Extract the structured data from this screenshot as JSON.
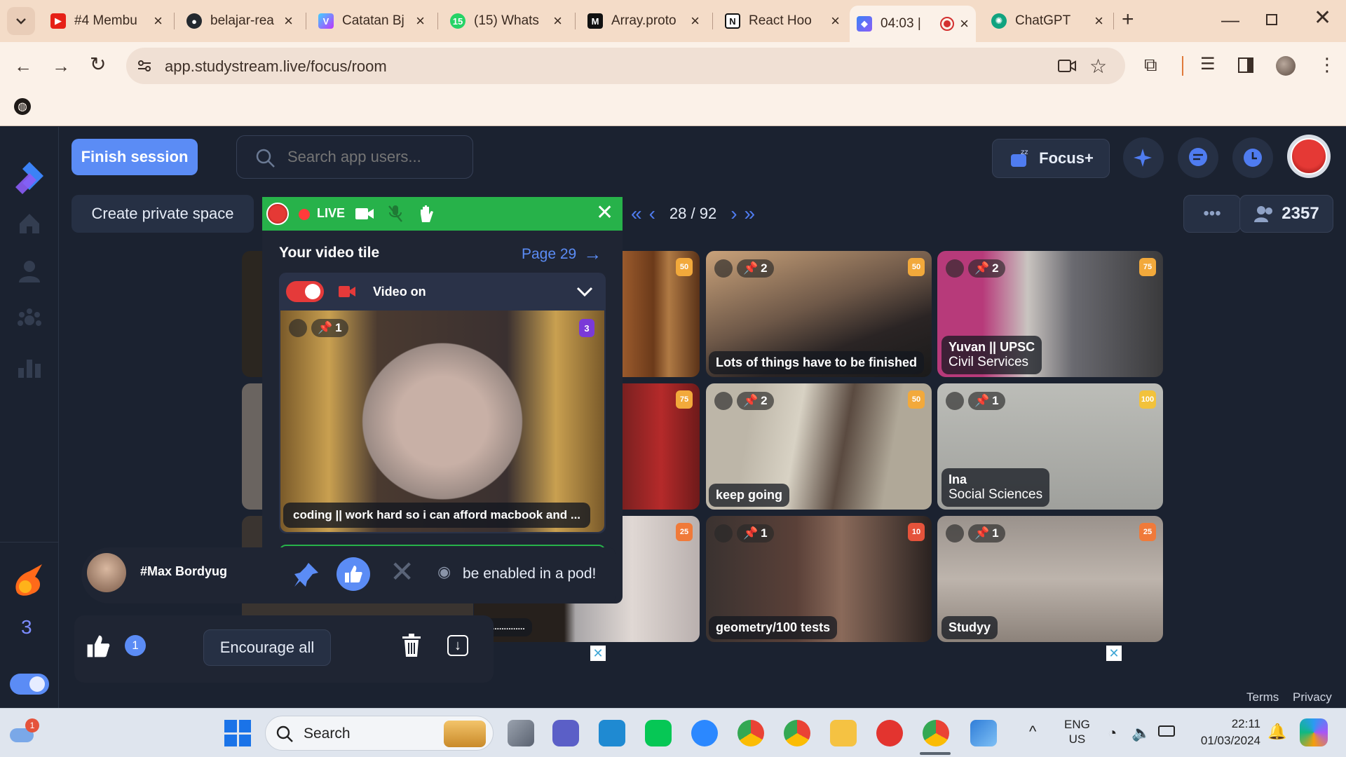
{
  "browser": {
    "tabs": [
      {
        "title": "#4 Membu",
        "favicon": "youtube-icon",
        "color": "#e62117",
        "active": false
      },
      {
        "title": "belajar-rea",
        "favicon": "github-icon",
        "color": "#24292f",
        "active": false
      },
      {
        "title": "Catatan Bj",
        "favicon": "vite-icon",
        "color": "#8a5cf6",
        "active": false
      },
      {
        "title": "(15) Whats",
        "favicon": "whatsapp-icon",
        "color": "#25d366",
        "active": false
      },
      {
        "title": "Array.proto",
        "favicon": "mdn-icon",
        "color": "#111111",
        "active": false
      },
      {
        "title": "React Hoo",
        "favicon": "notion-icon",
        "color": "#111111",
        "active": false
      },
      {
        "title": "04:03 |",
        "favicon": "studystream-icon",
        "color": "#3b82f6",
        "active": true
      },
      {
        "title": "ChatGPT",
        "favicon": "chatgpt-icon",
        "color": "#10a37f",
        "active": false
      }
    ],
    "url": "app.studystream.live/focus/room"
  },
  "app": {
    "finish_session": "Finish session",
    "search_placeholder": "Search app users...",
    "focus_plus": "Focus+",
    "create_private_space": "Create private space",
    "page_indicator": "28 / 92",
    "online_count": "2357",
    "streak_count": "3",
    "popup": {
      "live_label": "LIVE",
      "title": "Your video tile",
      "page_link": "Page 29",
      "video_toggle_label": "Video on",
      "self_pin_count": "1",
      "self_badge": "3",
      "self_status": "coding || work hard so i can afford macbook and ...",
      "status_input_value": "coding || work hard so i can afforc",
      "pod_notice": "be enabled in a pod!"
    },
    "encourage": {
      "user": "#Max Bordyug",
      "likes_count": "1",
      "encourage_all": "Encourage all"
    },
    "tiles": [
      {
        "pin": "2",
        "badge": "50",
        "status": "Lots of things have to be finished",
        "name": "",
        "sub": ""
      },
      {
        "pin": "2",
        "badge": "75",
        "status": "",
        "name": "Yuvan || UPSC",
        "sub": "Civil Services"
      },
      {
        "pin": "2",
        "badge": "50",
        "status": "keep going",
        "name": "",
        "sub": ""
      },
      {
        "pin": "1",
        "badge": "100",
        "status": "",
        "name": "Ina",
        "sub": "Social Sciences"
      },
      {
        "pin": "1",
        "badge": "10",
        "status": "geometry/100 tests",
        "name": "",
        "sub": ""
      },
      {
        "pin": "1",
        "badge": "25",
        "status": "",
        "name": "Studyy",
        "sub": ""
      }
    ],
    "partial_tile_status": "..............",
    "terms": "Terms",
    "privacy": "Privacy"
  },
  "taskbar": {
    "search": "Search",
    "lang": "ENG",
    "region": "US",
    "time": "22:11",
    "date": "01/03/2024",
    "weather_badge": "1"
  }
}
